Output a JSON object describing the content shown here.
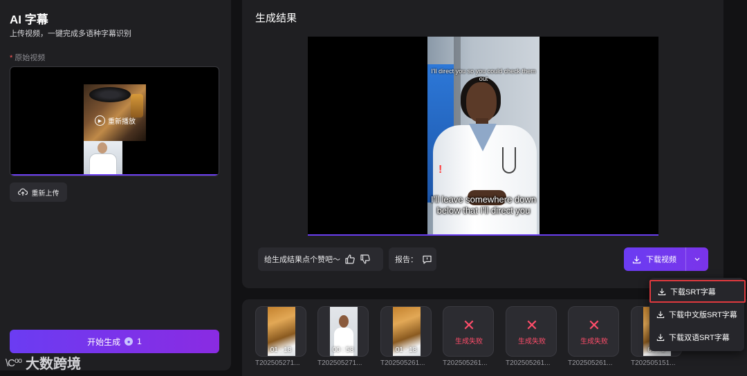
{
  "left": {
    "title": "AI 字幕",
    "subtitle": "上传视频，一键完成多语种字幕识别",
    "required_mark": "*",
    "video_label": "原始视频",
    "replay_label": "重新播放",
    "reupload_label": "重新上传",
    "start_label": "开始生成",
    "start_credits": "1"
  },
  "result": {
    "title": "生成结果",
    "caption_top": "I'll direct you so you could check them out",
    "caption_bottom": "I'll leave somewhere down below that I'll direct you",
    "feedback_label": "给生成结果点个赞吧～",
    "report_label": "报告：",
    "download_label": "下载视频"
  },
  "dropdown": {
    "items": [
      "下载SRT字幕",
      "下载中文版SRT字幕",
      "下载双语SRT字幕"
    ]
  },
  "history": [
    {
      "type": "food",
      "time": "01 : 18",
      "name": "T202505271..."
    },
    {
      "type": "woman",
      "time": "00 : 58",
      "name": "T202505271..."
    },
    {
      "type": "food",
      "time": "01 : 18",
      "name": "T202505261..."
    },
    {
      "type": "fail",
      "status": "生成失败",
      "name": "T202505261..."
    },
    {
      "type": "fail",
      "status": "生成失败",
      "name": "T202505261..."
    },
    {
      "type": "fail",
      "status": "生成失败",
      "name": "T202505261..."
    },
    {
      "type": "food",
      "time": "00 : 5",
      "name": "T202505151..."
    }
  ],
  "watermark": {
    "logo": "\\C⁰⁰",
    "text": "大数跨境"
  },
  "colors": {
    "accent": "#6b3cf2",
    "fail": "#ff4d6a",
    "highlight_border": "#e0393e"
  }
}
